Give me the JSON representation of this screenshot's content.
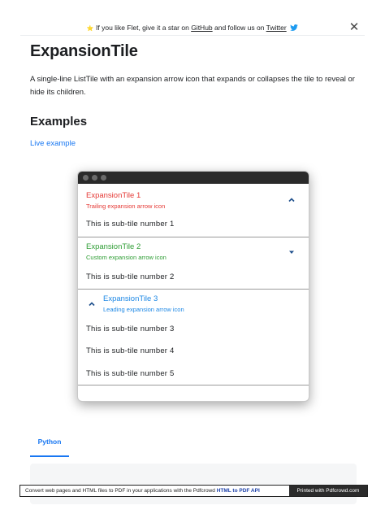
{
  "banner": {
    "star": "⭐",
    "text_before": "If you like Flet, give it a star on ",
    "github_link": "GitHub",
    "text_middle": " and follow us on ",
    "twitter_link": "Twitter",
    "close": "✕"
  },
  "page": {
    "title": "ExpansionTile",
    "description": "A single-line ListTile with an expansion arrow icon that expands or collapses the tile to reveal or hide its children.",
    "examples_heading": "Examples",
    "live_example": "Live example"
  },
  "app": {
    "tiles": [
      {
        "title": "ExpansionTile 1",
        "subtitle": "Trailing expansion arrow icon",
        "color": "#e53935",
        "arrow_icon": "chevron-up",
        "children": [
          "This is sub-tile number 1"
        ]
      },
      {
        "title": "ExpansionTile 2",
        "subtitle": "Custom expansion arrow icon",
        "color": "#2e9d34",
        "arrow_icon": "caret-down",
        "children": [
          "This is sub-tile number 2"
        ]
      },
      {
        "title": "ExpansionTile 3",
        "subtitle": "Leading expansion arrow icon",
        "color": "#1e88e5",
        "arrow_icon": "chevron-up",
        "children": [
          "This is sub-tile number 3",
          "This is sub-tile number 4",
          "This is sub-tile number 5"
        ]
      }
    ]
  },
  "code_tabs": {
    "active": "Python"
  },
  "footer": {
    "message_before": "Convert web pages and HTML files to PDF in your applications with the Pdfcrowd ",
    "api_link": "HTML to PDF API",
    "printed_with": "Printed with Pdfcrowd.com"
  },
  "colors": {
    "link": "#1877f2",
    "titlebar": "#2a2a2a"
  }
}
